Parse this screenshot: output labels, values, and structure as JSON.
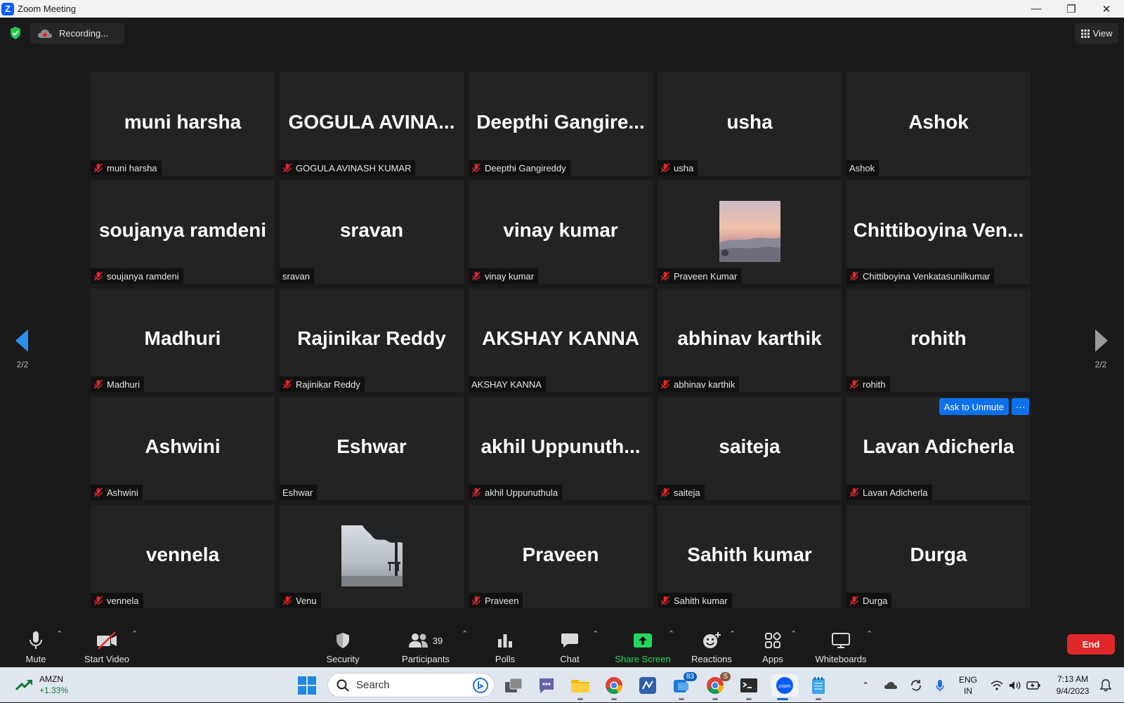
{
  "window": {
    "title": "Zoom Meeting",
    "minimize": "—",
    "restore": "❐",
    "close": "✕"
  },
  "top": {
    "recording_label": "Recording...",
    "view_label": "View"
  },
  "pager": {
    "left": "2/2",
    "right": "2/2"
  },
  "participants": [
    {
      "display": "muni harsha",
      "label": "muni harsha",
      "muted": true
    },
    {
      "display": "GOGULA  AVINA...",
      "label": "GOGULA AVINASH KUMAR",
      "muted": true
    },
    {
      "display": "Deepthi  Gangire...",
      "label": "Deepthi Gangireddy",
      "muted": true
    },
    {
      "display": "usha",
      "label": "usha",
      "muted": true
    },
    {
      "display": "Ashok",
      "label": "Ashok",
      "muted": false
    },
    {
      "display": "soujanya ramdeni",
      "label": "soujanya ramdeni",
      "muted": true
    },
    {
      "display": "sravan",
      "label": "sravan",
      "muted": false
    },
    {
      "display": "vinay kumar",
      "label": "vinay kumar",
      "muted": true
    },
    {
      "display": "",
      "label": "Praveen Kumar",
      "muted": true,
      "photo": "sunset-mountains"
    },
    {
      "display": "Chittiboyina  Ven...",
      "label": "Chittiboyina Venkatasunilkumar",
      "muted": true
    },
    {
      "display": "Madhuri",
      "label": "Madhuri",
      "muted": true
    },
    {
      "display": "Rajinikar Reddy",
      "label": "Rajinikar Reddy",
      "muted": true
    },
    {
      "display": "AKSHAY KANNA",
      "label": "AKSHAY KANNA",
      "muted": false
    },
    {
      "display": "abhinav karthik",
      "label": "abhinav karthik",
      "muted": true
    },
    {
      "display": "rohith",
      "label": "rohith",
      "muted": true
    },
    {
      "display": "Ashwini",
      "label": "Ashwini",
      "muted": true
    },
    {
      "display": "Eshwar",
      "label": "Eshwar",
      "muted": false
    },
    {
      "display": "akhil  Uppunuth...",
      "label": "akhil Uppunuthula",
      "muted": true
    },
    {
      "display": "saiteja",
      "label": "saiteja",
      "muted": true
    },
    {
      "display": "Lavan Adicherla",
      "label": "Lavan Adicherla",
      "muted": true,
      "hover": true
    },
    {
      "display": "vennela",
      "label": "vennela",
      "muted": true
    },
    {
      "display": "",
      "label": "Venu",
      "muted": true,
      "photo": "tree-bench"
    },
    {
      "display": "Praveen",
      "label": "Praveen",
      "muted": true
    },
    {
      "display": "Sahith kumar",
      "label": "Sahith kumar",
      "muted": true
    },
    {
      "display": "Durga",
      "label": "Durga",
      "muted": true
    }
  ],
  "hover_controls": {
    "ask_unmute": "Ask to Unmute",
    "more": "···"
  },
  "toolbar": {
    "mute": "Mute",
    "start_video": "Start Video",
    "security": "Security",
    "participants": "Participants",
    "participants_count": "39",
    "polls": "Polls",
    "chat": "Chat",
    "share_screen": "Share Screen",
    "reactions": "Reactions",
    "apps": "Apps",
    "whiteboards": "Whiteboards",
    "end": "End"
  },
  "taskbar": {
    "stock_symbol": "AMZN",
    "stock_change": "+1.33%",
    "search_placeholder": "Search",
    "teams_badge": "83",
    "chrome_badge": "S",
    "lang_line1": "ENG",
    "lang_line2": "IN",
    "time": "7:13 AM",
    "date": "9/4/2023"
  },
  "colors": {
    "accent_blue": "#0e71eb",
    "share_green": "#23d959",
    "end_red": "#e02828",
    "muted_red": "#e02828"
  }
}
